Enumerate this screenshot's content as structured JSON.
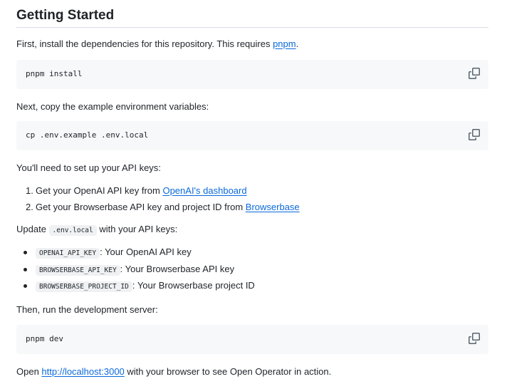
{
  "heading": "Getting Started",
  "intro": {
    "prefix": "First, install the dependencies for this repository. This requires ",
    "link": "pnpm",
    "suffix": "."
  },
  "code_install": "pnpm install",
  "env_intro": "Next, copy the example environment variables:",
  "code_env": "cp .env.example .env.local",
  "keys_intro": "You'll need to set up your API keys:",
  "steps": [
    {
      "num": "1.",
      "text": "Get your OpenAI API key from ",
      "link": "OpenAI's dashboard"
    },
    {
      "num": "2.",
      "text": "Get your Browserbase API key and project ID from ",
      "link": "Browserbase"
    }
  ],
  "update": {
    "prefix": "Update ",
    "code": ".env.local",
    "suffix": " with your API keys:"
  },
  "env_vars": [
    {
      "name": "OPENAI_API_KEY",
      "desc": ": Your OpenAI API key"
    },
    {
      "name": "BROWSERBASE_API_KEY",
      "desc": ": Your Browserbase API key"
    },
    {
      "name": "BROWSERBASE_PROJECT_ID",
      "desc": ": Your Browserbase project ID"
    }
  ],
  "run_intro": "Then, run the development server:",
  "code_dev": "pnpm dev",
  "open": {
    "prefix": "Open ",
    "link": "http://localhost:3000",
    "suffix": " with your browser to see Open Operator in action."
  },
  "icons": {
    "copy": "copy-icon"
  },
  "colors": {
    "link": "#0969da",
    "code_bg": "#f6f8fa",
    "text": "#1f2328"
  }
}
